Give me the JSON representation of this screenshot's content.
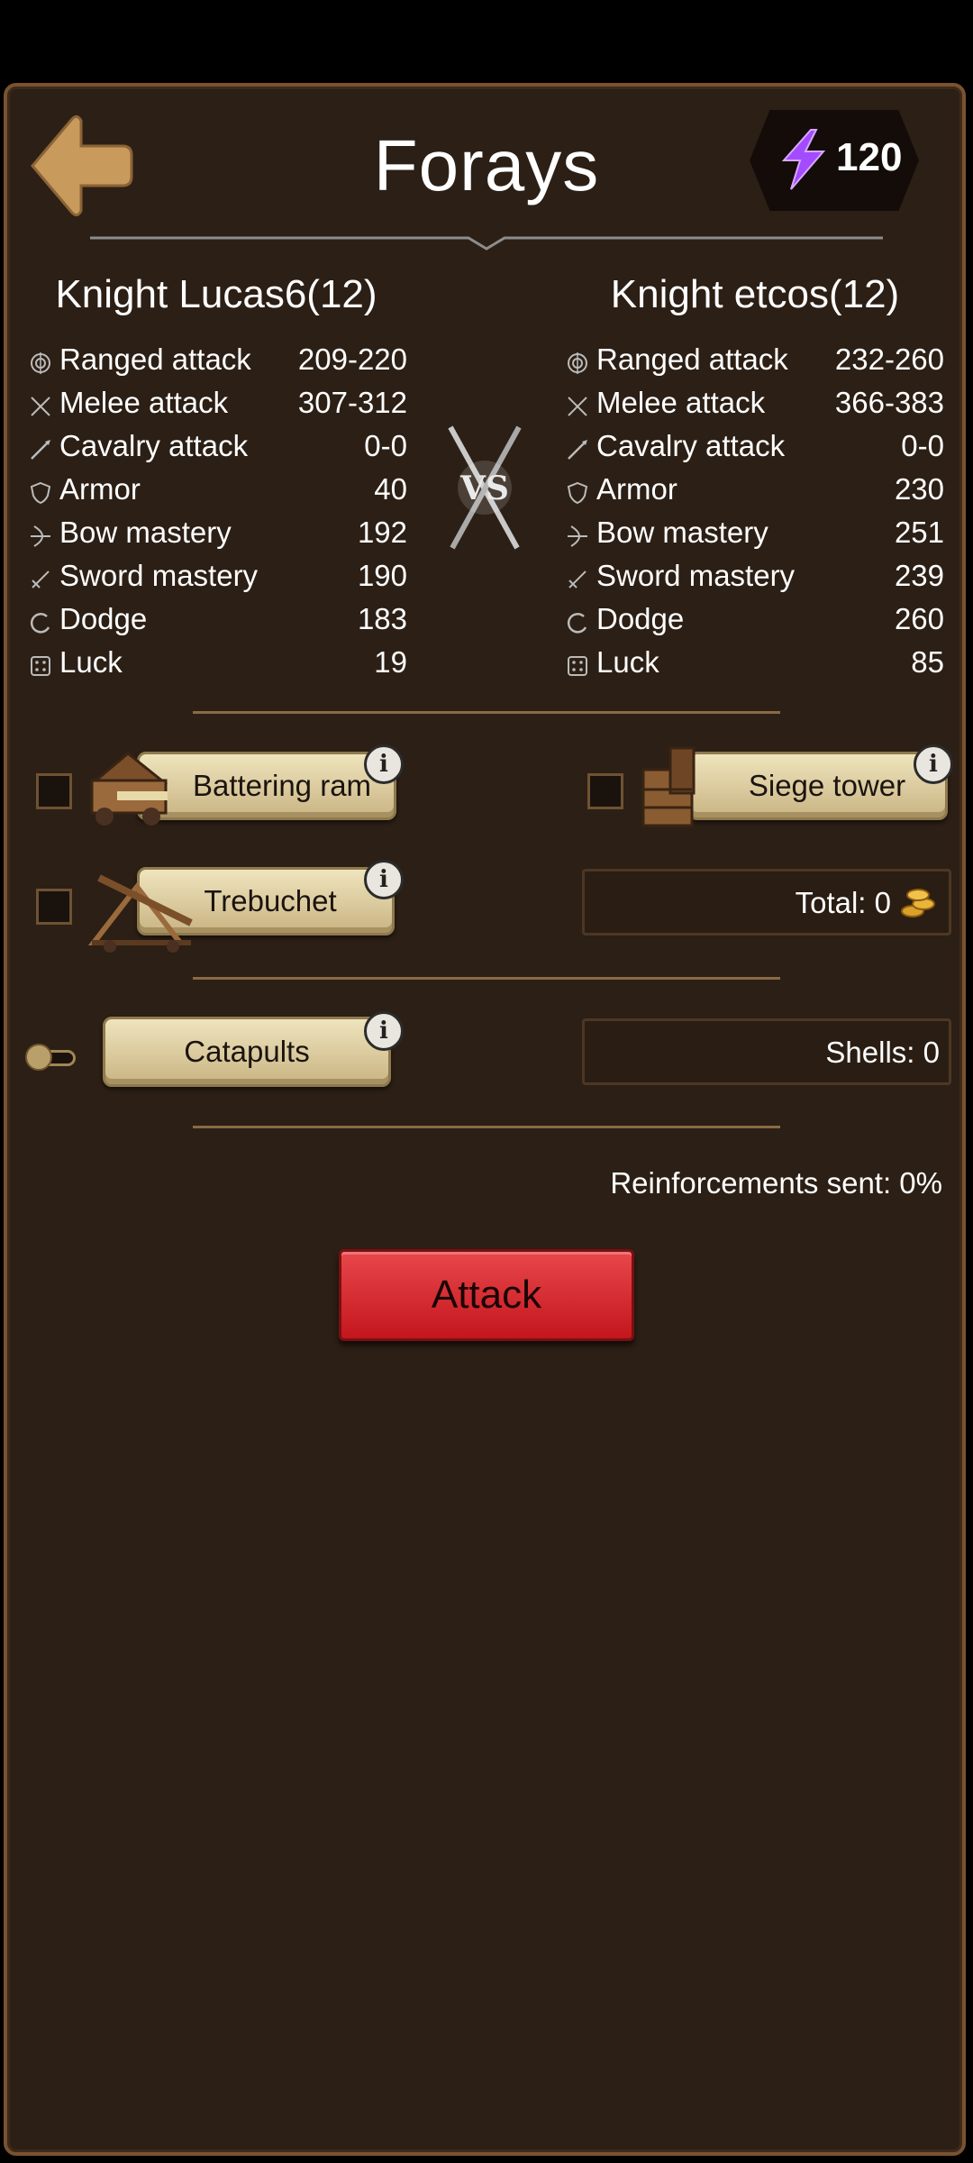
{
  "header": {
    "title": "Forays",
    "energy_value": "120"
  },
  "left_knight": {
    "name": "Knight Lucas6(12)",
    "stats": [
      {
        "icon": "target-icon",
        "label": "Ranged attack",
        "value": "209-220"
      },
      {
        "icon": "crossed-swords-icon",
        "label": "Melee attack",
        "value": "307-312"
      },
      {
        "icon": "lance-icon",
        "label": "Cavalry attack",
        "value": "0-0"
      },
      {
        "icon": "shield-icon",
        "label": "Armor",
        "value": "40"
      },
      {
        "icon": "bow-icon",
        "label": "Bow mastery",
        "value": "192"
      },
      {
        "icon": "sword-icon",
        "label": "Sword mastery",
        "value": "190"
      },
      {
        "icon": "dodge-icon",
        "label": "Dodge",
        "value": "183"
      },
      {
        "icon": "dice-icon",
        "label": "Luck",
        "value": "19"
      }
    ]
  },
  "right_knight": {
    "name": "Knight etcos(12)",
    "stats": [
      {
        "icon": "target-icon",
        "label": "Ranged attack",
        "value": "232-260"
      },
      {
        "icon": "crossed-swords-icon",
        "label": "Melee attack",
        "value": "366-383"
      },
      {
        "icon": "lance-icon",
        "label": "Cavalry attack",
        "value": "0-0"
      },
      {
        "icon": "shield-icon",
        "label": "Armor",
        "value": "230"
      },
      {
        "icon": "bow-icon",
        "label": "Bow mastery",
        "value": "251"
      },
      {
        "icon": "sword-icon",
        "label": "Sword mastery",
        "value": "239"
      },
      {
        "icon": "dodge-icon",
        "label": "Dodge",
        "value": "260"
      },
      {
        "icon": "dice-icon",
        "label": "Luck",
        "value": "85"
      }
    ]
  },
  "vs_label": "VS",
  "siege": {
    "battering_ram": {
      "label": "Battering ram",
      "checked": false
    },
    "siege_tower": {
      "label": "Siege tower",
      "checked": false
    },
    "trebuchet": {
      "label": "Trebuchet",
      "checked": false
    },
    "total_text": "Total: 0"
  },
  "catapults": {
    "label": "Catapults",
    "toggle_on": false,
    "shells_text": "Shells: 0"
  },
  "reinforcements_text": "Reinforcements sent: 0%",
  "attack_label": "Attack",
  "info_glyph": "i",
  "colors": {
    "background": "#2c1f15",
    "accent_gold": "#c9b483",
    "attack_red": "#d62a30",
    "energy_purple": "#a34bff"
  }
}
